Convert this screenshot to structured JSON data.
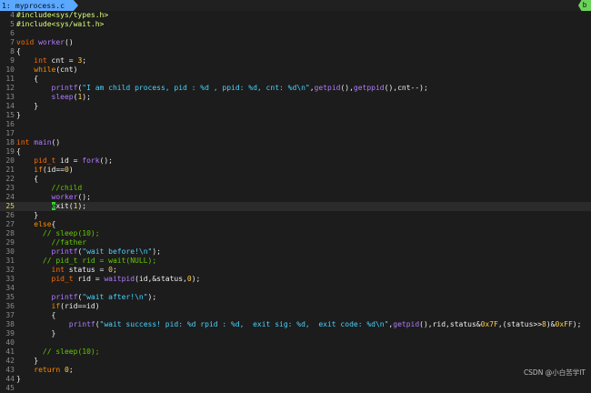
{
  "tabbar": {
    "tab_label": "1: myprocess.c",
    "right_badge": "b"
  },
  "editor": {
    "lines": [
      {
        "n": "4",
        "t": "#include<sys/types.h>"
      },
      {
        "n": "5",
        "t": "#include<sys/wait.h>"
      },
      {
        "n": "6",
        "t": ""
      },
      {
        "n": "7",
        "t": "void worker()"
      },
      {
        "n": "8",
        "t": "{"
      },
      {
        "n": "9",
        "t": "    int cnt = 3;"
      },
      {
        "n": "10",
        "t": "    while(cnt)"
      },
      {
        "n": "11",
        "t": "    {"
      },
      {
        "n": "12",
        "t": "        printf(\"I am child process, pid : %d , ppid: %d, cnt: %d\\n\",getpid(),getppid(),cnt--);"
      },
      {
        "n": "13",
        "t": "        sleep(1);"
      },
      {
        "n": "14",
        "t": "    }"
      },
      {
        "n": "15",
        "t": "}"
      },
      {
        "n": "16",
        "t": ""
      },
      {
        "n": "17",
        "t": ""
      },
      {
        "n": "18",
        "t": "int main()"
      },
      {
        "n": "19",
        "t": "{"
      },
      {
        "n": "20",
        "t": "    pid_t id = fork();"
      },
      {
        "n": "21",
        "t": "    if(id==0)"
      },
      {
        "n": "22",
        "t": "    {"
      },
      {
        "n": "23",
        "t": "        //child"
      },
      {
        "n": "24",
        "t": "        worker();"
      },
      {
        "n": "25",
        "t": "        exit(1);"
      },
      {
        "n": "26",
        "t": "    }"
      },
      {
        "n": "27",
        "t": "    else{"
      },
      {
        "n": "28",
        "t": "      // sleep(10);"
      },
      {
        "n": "29",
        "t": "        //father"
      },
      {
        "n": "30",
        "t": "        printf(\"wait before!\\n\");"
      },
      {
        "n": "31",
        "t": "      // pid_t rid = wait(NULL);"
      },
      {
        "n": "32",
        "t": "        int status = 0;"
      },
      {
        "n": "33",
        "t": "        pid_t rid = waitpid(id,&status,0);"
      },
      {
        "n": "34",
        "t": ""
      },
      {
        "n": "35",
        "t": "        printf(\"wait after!\\n\");"
      },
      {
        "n": "36",
        "t": "        if(rid==id)"
      },
      {
        "n": "37",
        "t": "        {"
      },
      {
        "n": "38",
        "t": "            printf(\"wait success! pid: %d rpid : %d,  exit sig: %d,  exit code: %d\\n\",getpid(),rid,status&0x7F,(status>>8)&0xFF);"
      },
      {
        "n": "39",
        "t": "        }"
      },
      {
        "n": "40",
        "t": ""
      },
      {
        "n": "41",
        "t": "      // sleep(10);"
      },
      {
        "n": "42",
        "t": "    }"
      },
      {
        "n": "43",
        "t": "    return 0;"
      },
      {
        "n": "44",
        "t": "}"
      },
      {
        "n": "45",
        "t": ""
      }
    ],
    "current_line": "25"
  },
  "watermark": "CSDN @小白苦学IT",
  "colors": {
    "background": "#1c1c1c",
    "tab_blue": "#5aa8ff",
    "badge_green": "#6bd35a",
    "keyword_orange": "#ff6a00",
    "function_purple": "#b07cff",
    "string_cyan": "#47d4ff",
    "comment_green": "#63c800",
    "number_yellow": "#ffcf4a"
  }
}
